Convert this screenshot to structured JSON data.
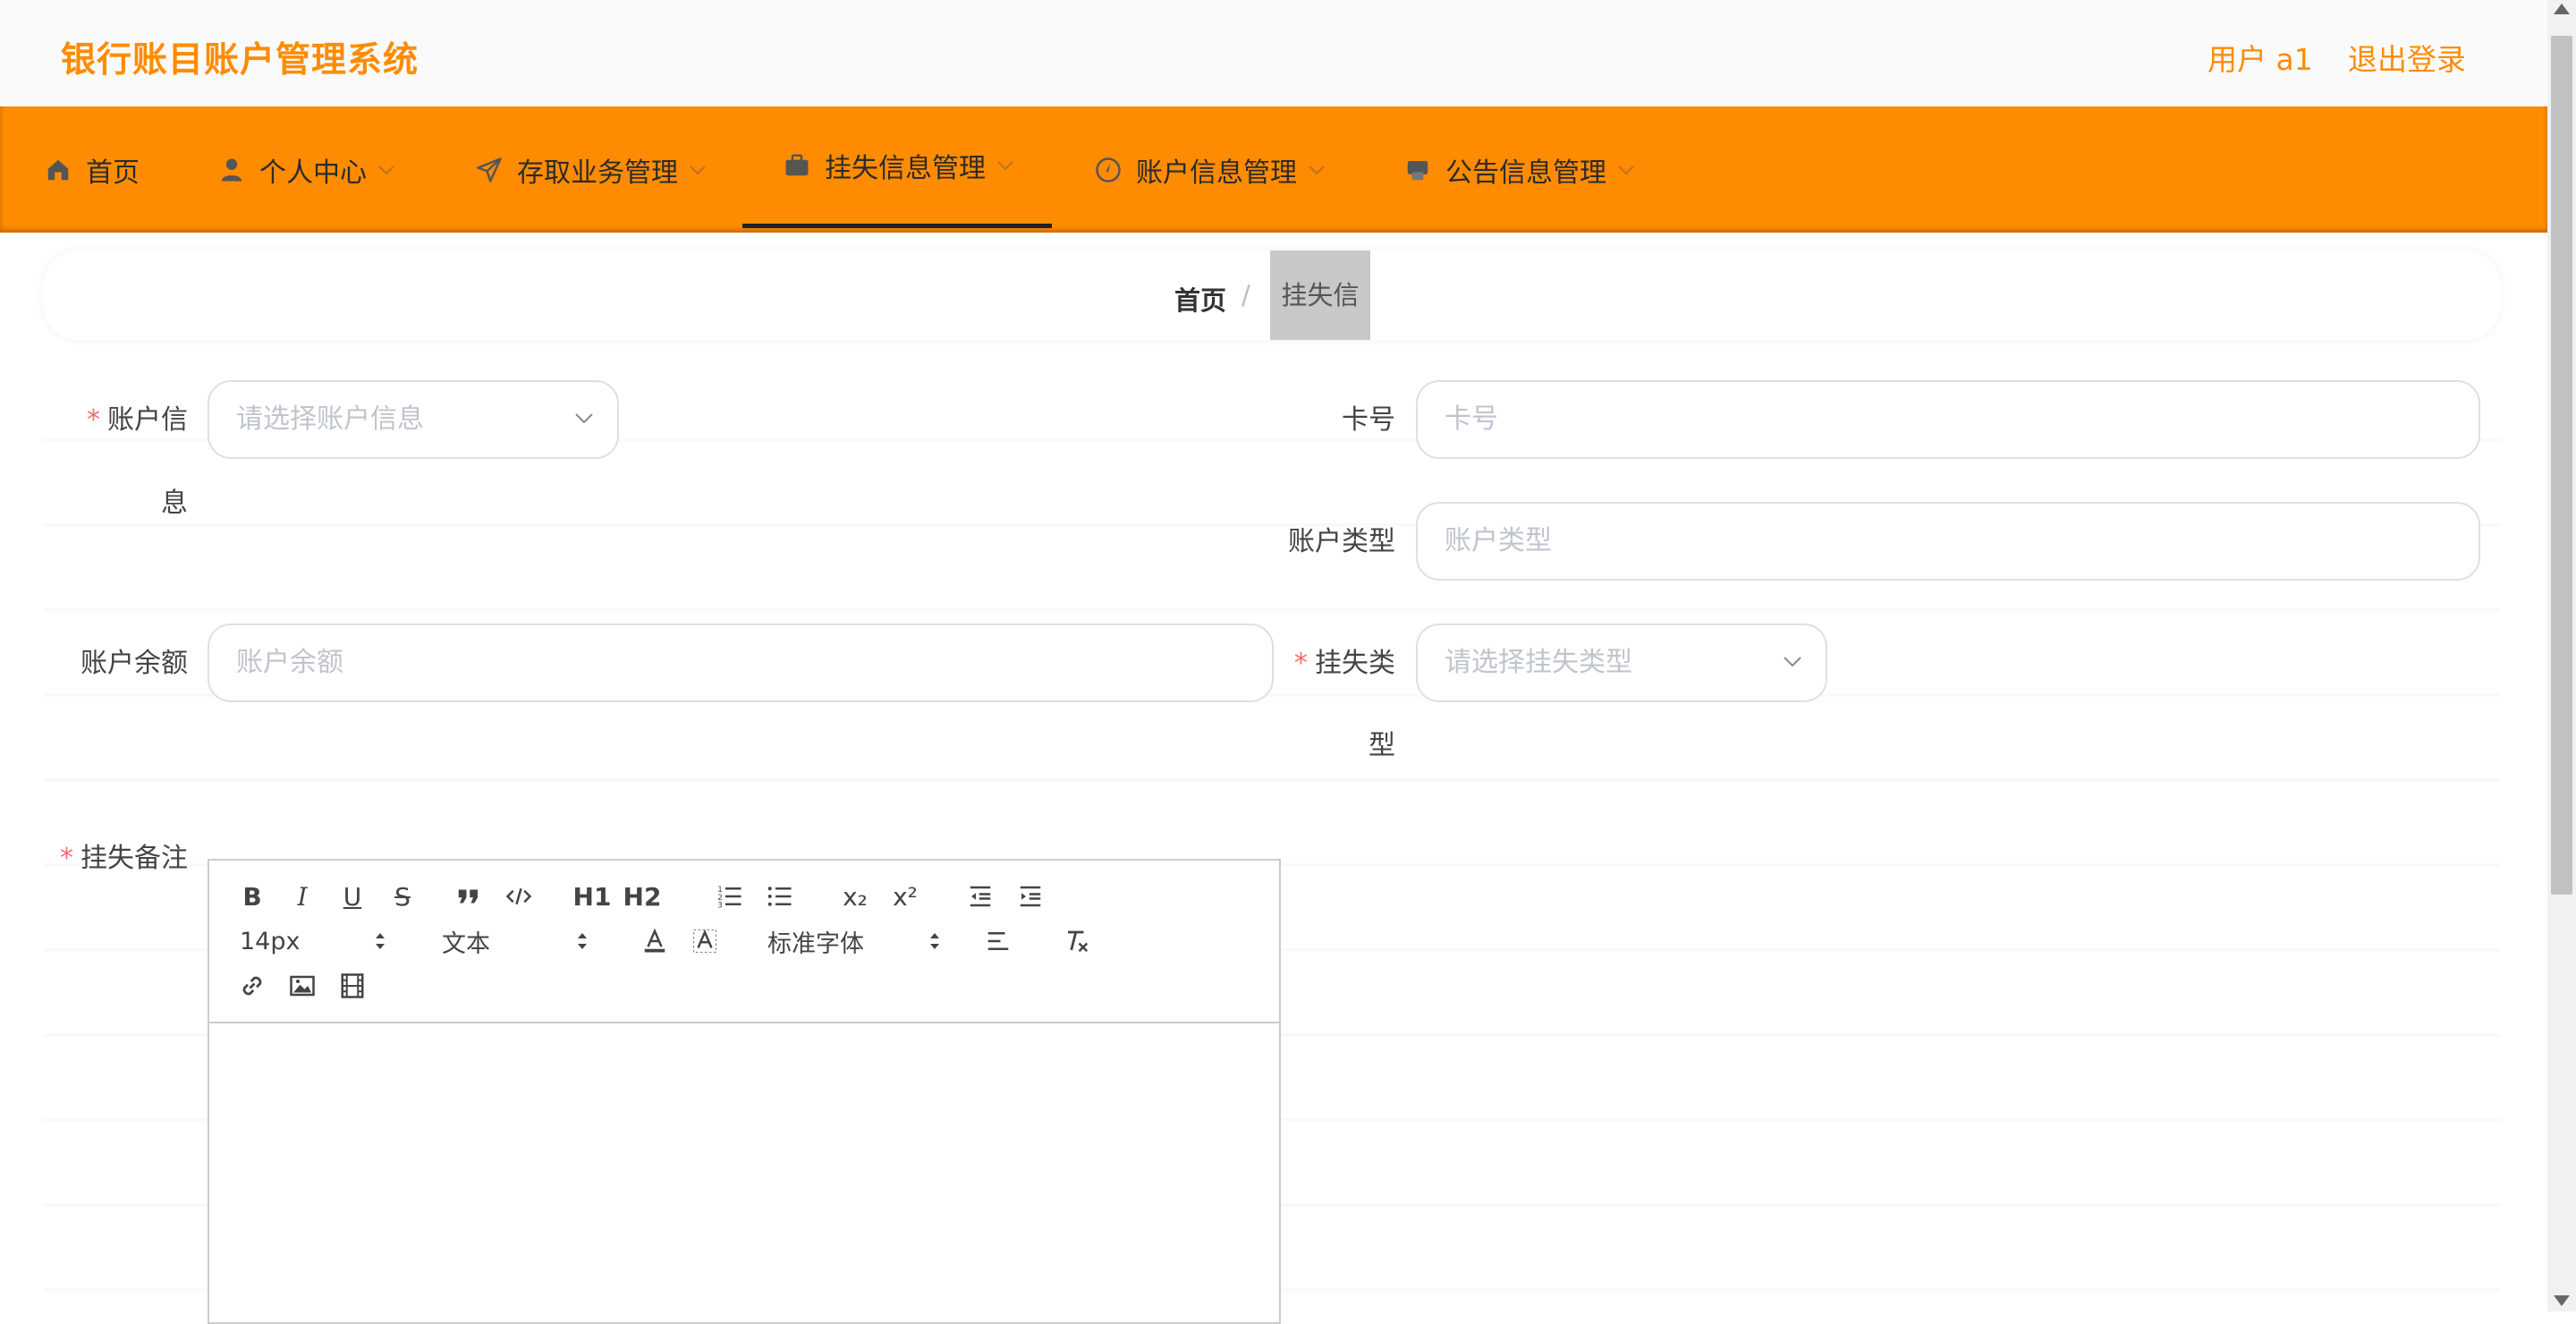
{
  "header": {
    "title": "银行账目账户管理系统",
    "user_label": "用户 a1",
    "logout_label": "退出登录"
  },
  "nav": {
    "items": [
      {
        "label": "首页",
        "icon": "home-icon",
        "has_dropdown": false
      },
      {
        "label": "个人中心",
        "icon": "user-icon",
        "has_dropdown": true
      },
      {
        "label": "存取业务管理",
        "icon": "send-icon",
        "has_dropdown": true
      },
      {
        "label": "挂失信息管理",
        "icon": "briefcase-icon",
        "has_dropdown": true,
        "active": true
      },
      {
        "label": "账户信息管理",
        "icon": "compass-icon",
        "has_dropdown": true
      },
      {
        "label": "公告信息管理",
        "icon": "printer-icon",
        "has_dropdown": true
      }
    ]
  },
  "breadcrumb": {
    "home": "首页",
    "separator": "/",
    "current": "挂失信息"
  },
  "form": {
    "account_info": {
      "label_line1": "账户信",
      "label_line2": "息",
      "required": "*",
      "placeholder": "请选择账户信息"
    },
    "card_no": {
      "label": "卡号",
      "placeholder": "卡号"
    },
    "account_type": {
      "label": "账户类型",
      "placeholder": "账户类型"
    },
    "balance": {
      "label": "账户余额",
      "placeholder": "账户余额"
    },
    "loss_type": {
      "label_line1": "挂失类",
      "label_line2": "型",
      "required": "*",
      "placeholder": "请选择挂失类型"
    },
    "loss_note": {
      "label": "挂失备注",
      "required": "*"
    }
  },
  "editor": {
    "font_size": "14px",
    "header_picker": "文本",
    "font_family": "标准字体",
    "buttons": {
      "bold": "B",
      "italic": "I",
      "underline": "U",
      "strike": "S",
      "h1": "H1",
      "h2": "H2",
      "sub": "x₂",
      "sup": "x²"
    }
  },
  "colors": {
    "brand": "#ff8c00",
    "required": "#f56c6c",
    "placeholder": "#c0c4cc",
    "border": "#dcdfe6"
  }
}
